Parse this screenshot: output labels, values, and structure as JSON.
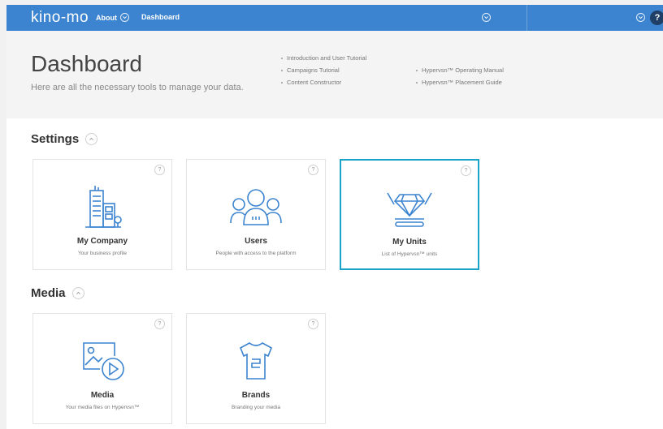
{
  "topbar": {
    "logo": "kino-mo",
    "about_label": "About",
    "dashboard_label": "Dashboard",
    "help_label": "?"
  },
  "header": {
    "title": "Dashboard",
    "subtitle": "Here are all the necessary tools to manage your data.",
    "links_col1": [
      "Introduction and User Tutorial",
      "Campaigns Tutorial",
      "Content Constructor"
    ],
    "links_col2": [
      "Hypervsn™ Operating Manual",
      "Hypervsn™ Placement Guide"
    ]
  },
  "sections": {
    "settings": {
      "title": "Settings",
      "cards": [
        {
          "title": "My Company",
          "desc": "Your business profile",
          "icon": "building-icon",
          "selected": false
        },
        {
          "title": "Users",
          "desc": "People with access to the platform",
          "icon": "users-icon",
          "selected": false
        },
        {
          "title": "My Units",
          "desc": "List of Hypervsn™ units",
          "icon": "diamond-hologram-icon",
          "selected": true
        }
      ]
    },
    "media": {
      "title": "Media",
      "cards": [
        {
          "title": "Media",
          "desc": "Your media files on Hypervsn™",
          "icon": "media-icon",
          "selected": false
        },
        {
          "title": "Brands",
          "desc": "Branding your media",
          "icon": "tshirt-icon",
          "selected": false
        }
      ]
    }
  },
  "card_help_label": "?",
  "colors": {
    "topbar": "#3c84cf",
    "selected_border": "#1aa3c8",
    "icon_stroke": "#3c84cf"
  }
}
